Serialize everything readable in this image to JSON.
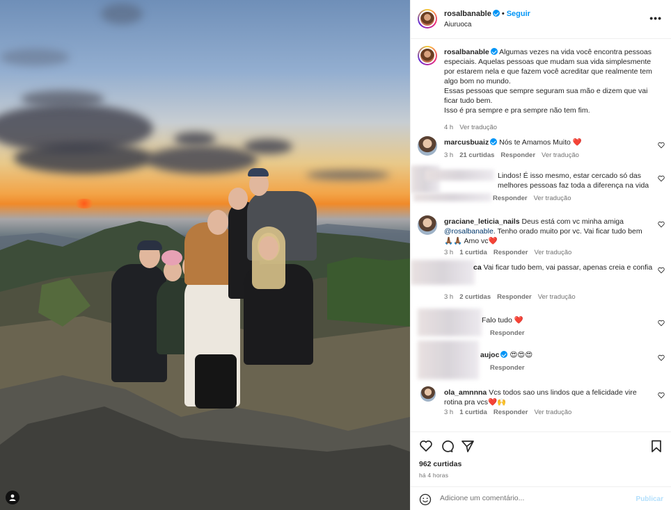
{
  "post": {
    "username": "rosalbanable",
    "location": "Aiuruoca",
    "follow_label": "Seguir",
    "more_label": "•••"
  },
  "caption": {
    "username": "rosalbanable",
    "lines": [
      "Algumas vezes na vida você encontra pessoas especiais. Aquelas pessoas que mudam sua vida simplesmente por estarem nela e que fazem você acreditar que realmente tem algo bom no mundo.",
      "Essas pessoas que sempre seguram sua mão e dizem que vai ficar tudo bem.",
      "Isso é pra sempre e pra sempre não tem fim."
    ],
    "time": "4 h",
    "translate": "Ver tradução"
  },
  "comments": [
    {
      "username": "marcusbuaiz",
      "verified": true,
      "text": "Nós te Amamos Muito ❤️",
      "time": "3 h",
      "likes": "21 curtidas",
      "reply": "Responder",
      "translate": "Ver tradução"
    },
    {
      "username": "",
      "verified": false,
      "text": "Lindos! É isso mesmo, estar cercado só das melhores pessoas faz toda a diferença na vida",
      "time": "",
      "likes": "",
      "reply": "Responder",
      "translate": "Ver tradução"
    },
    {
      "username": "graciane_leticia_nails",
      "verified": false,
      "text": "Deus está com vc minha amiga",
      "mention": "@rosalbanable",
      "text2": ". Tenho orado muito por vc. Vai ficar tudo bem 🙏🏾🙏🏾 Amo vc❤️",
      "time": "3 h",
      "likes": "1 curtida",
      "reply": "Responder",
      "translate": "Ver tradução"
    },
    {
      "username": "ca",
      "verified": false,
      "text": "Vai ficar tudo bem, vai passar, apenas creia e confia",
      "time": "3 h",
      "likes": "2 curtidas",
      "reply": "Responder",
      "translate": "Ver tradução"
    },
    {
      "username": "",
      "verified": false,
      "text": "Falo tudo ❤️",
      "time": "",
      "likes": "",
      "reply": "Responder",
      "translate": ""
    },
    {
      "username": "aujoc",
      "verified": true,
      "text": "😍😍😍",
      "time": "",
      "likes": "",
      "reply": "Responder",
      "translate": ""
    },
    {
      "username": "ola_amnnna",
      "verified": false,
      "text": "Vcs todos sao uns lindos que a felicidade vire rotina pra vcs❤️🙌",
      "time": "3 h",
      "likes": "1 curtida",
      "reply": "Responder",
      "translate": "Ver tradução"
    }
  ],
  "footer": {
    "likes": "962 curtidas",
    "ago": "há 4 horas",
    "add_comment_placeholder": "Adicione um comentário...",
    "publish": "Publicar"
  },
  "icons": {
    "like": "heart-icon",
    "comment": "comment-icon",
    "share": "share-icon",
    "save": "bookmark-icon",
    "emoji": "smile-icon",
    "options": "more-icon"
  }
}
